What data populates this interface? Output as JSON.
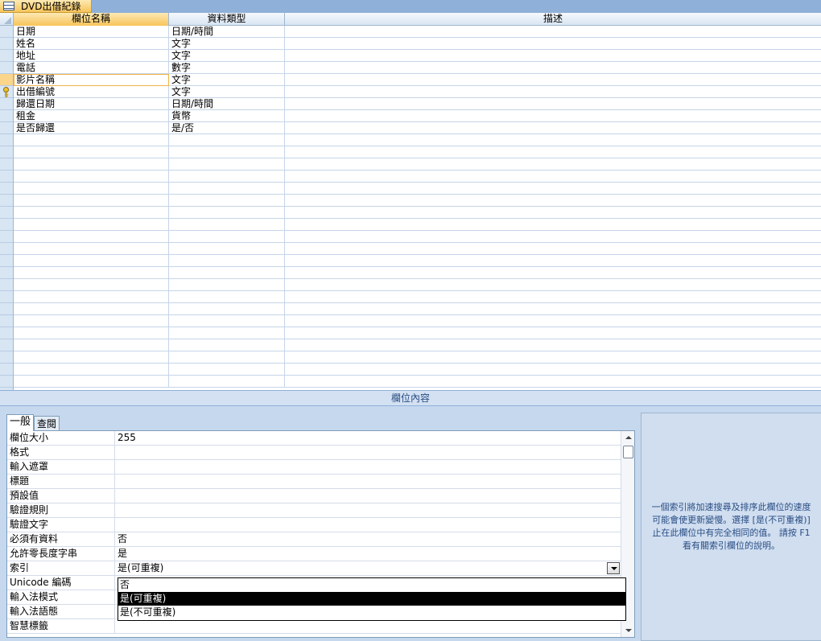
{
  "tab": {
    "title": "DVD出借紀錄"
  },
  "columns": {
    "field_name": "欄位名稱",
    "data_type": "資料類型",
    "description": "描述"
  },
  "fields": [
    {
      "name": "日期",
      "type": "日期/時間",
      "desc": ""
    },
    {
      "name": "姓名",
      "type": "文字",
      "desc": ""
    },
    {
      "name": "地址",
      "type": "文字",
      "desc": ""
    },
    {
      "name": "電話",
      "type": "數字",
      "desc": ""
    },
    {
      "name": "影片名稱",
      "type": "文字",
      "desc": ""
    },
    {
      "name": "出借編號",
      "type": "文字",
      "desc": ""
    },
    {
      "name": "歸還日期",
      "type": "日期/時間",
      "desc": ""
    },
    {
      "name": "租金",
      "type": "貨幣",
      "desc": ""
    },
    {
      "name": "是否歸還",
      "type": "是/否",
      "desc": ""
    }
  ],
  "properties_panel": {
    "title": "欄位內容",
    "tabs": [
      "一般",
      "查閱"
    ],
    "rows": [
      {
        "label": "欄位大小",
        "value": "255"
      },
      {
        "label": "格式",
        "value": ""
      },
      {
        "label": "輸入遮罩",
        "value": ""
      },
      {
        "label": "標題",
        "value": ""
      },
      {
        "label": "預設值",
        "value": ""
      },
      {
        "label": "驗證規則",
        "value": ""
      },
      {
        "label": "驗證文字",
        "value": ""
      },
      {
        "label": "必須有資料",
        "value": "否"
      },
      {
        "label": "允許零長度字串",
        "value": "是"
      },
      {
        "label": "索引",
        "value": "是(可重複)"
      },
      {
        "label": "Unicode 編碼",
        "value": ""
      },
      {
        "label": "輸入法模式",
        "value": ""
      },
      {
        "label": "輸入法語態",
        "value": ""
      },
      {
        "label": "智慧標籤",
        "value": ""
      }
    ],
    "dropdown_options": [
      "否",
      "是(可重複)",
      "是(不可重複)"
    ],
    "dropdown_selected": "是(可重複)",
    "help_text": "一個索引將加速搜尋及排序此欄位的速度\n可能會使更新變慢。選擇 [是(不可重複)]\n止在此欄位中有完全相同的值。 請按 F1\n看有關索引欄位的說明。"
  },
  "primary_key_field": "出借編號",
  "active_field": "影片名稱"
}
